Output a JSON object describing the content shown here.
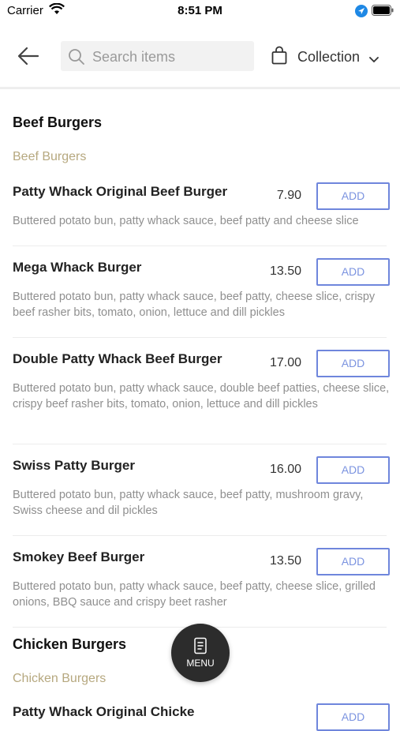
{
  "status_bar": {
    "carrier": "Carrier",
    "time": "8:51 PM"
  },
  "header": {
    "search_placeholder": "Search items",
    "collection_label": "Collection"
  },
  "sections": [
    {
      "title": "Beef Burgers",
      "subtitle": "Beef Burgers"
    },
    {
      "title": "Chicken Burgers",
      "subtitle": "Chicken Burgers"
    }
  ],
  "items": [
    {
      "name": "Patty Whack Original Beef Burger",
      "price": "7.90",
      "add_label": "ADD",
      "description": "Buttered potato bun, patty whack sauce, beef patty and cheese slice"
    },
    {
      "name": "Mega Whack Burger",
      "price": "13.50",
      "add_label": "ADD",
      "description": "Buttered potato bun, patty whack sauce, beef patty, cheese slice, crispy beef rasher bits, tomato, onion, lettuce and dill pickles"
    },
    {
      "name": "Double Patty Whack Beef Burger",
      "price": "17.00",
      "add_label": "ADD",
      "description": "Buttered potato bun, patty whack sauce, double beef patties, cheese slice, crispy beef rasher bits, tomato, onion, lettuce and dill pickles"
    },
    {
      "name": "Swiss Patty Burger",
      "price": "16.00",
      "add_label": "ADD",
      "description": "Buttered potato bun, patty whack sauce, beef patty, mushroom gravy, Swiss cheese and dil pickles"
    },
    {
      "name": "Smokey Beef Burger",
      "price": "13.50",
      "add_label": "ADD",
      "description": "Buttered potato bun, patty whack sauce, beef patty, cheese slice, grilled onions, BBQ sauce and crispy beet rasher"
    },
    {
      "name": "Patty Whack Original Chicke",
      "price": "",
      "add_label": "ADD",
      "description": ""
    }
  ],
  "menu_button": {
    "label": "MENU"
  },
  "colors": {
    "accent": "#6f86dc",
    "section_sub": "#b6a87f",
    "fab": "#2c2c2c"
  }
}
